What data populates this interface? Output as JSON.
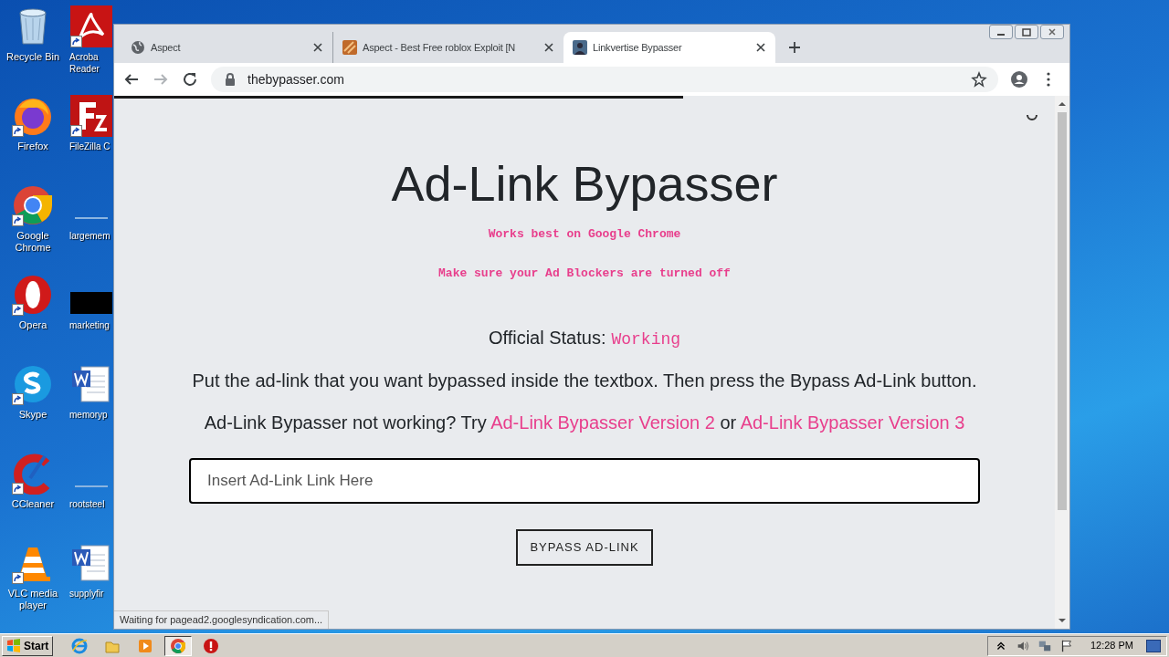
{
  "desktop_icons": [
    {
      "label": "Recycle Bin",
      "kind": "bin",
      "shortcut": false
    },
    {
      "label": "Firefox",
      "kind": "firefox",
      "shortcut": true
    },
    {
      "label": "Google Chrome",
      "kind": "chrome",
      "shortcut": true
    },
    {
      "label": "Opera",
      "kind": "opera",
      "shortcut": true
    },
    {
      "label": "Skype",
      "kind": "skype",
      "shortcut": true
    },
    {
      "label": "CCleaner",
      "kind": "ccleaner",
      "shortcut": true
    },
    {
      "label": "VLC media player",
      "kind": "vlc",
      "shortcut": true
    }
  ],
  "desktop_icons_column_2": [
    {
      "label": "Acroba Reader",
      "kind": "acrobat",
      "shortcut": true
    },
    {
      "label": "FileZilla C",
      "kind": "filezilla",
      "shortcut": true
    },
    {
      "label": "largemem",
      "kind": "blank",
      "shortcut": false
    },
    {
      "label": "marketing",
      "kind": "black",
      "shortcut": false
    },
    {
      "label": "memoryp",
      "kind": "word",
      "shortcut": false
    },
    {
      "label": "rootsteel",
      "kind": "blank",
      "shortcut": false
    },
    {
      "label": "supplyfir",
      "kind": "word",
      "shortcut": false
    }
  ],
  "browser": {
    "tabs": [
      {
        "title": "Aspect",
        "kind": "globe",
        "selected": false
      },
      {
        "title": "Aspect - Best Free roblox Exploit [N",
        "kind": "exploit",
        "selected": false
      },
      {
        "title": "Linkvertise Bypasser",
        "kind": "avatar",
        "selected": true
      }
    ],
    "address": "thebypasser.com",
    "page": {
      "title": "Ad-Link Bypasser",
      "notes": [
        "Works best on Google Chrome",
        "Make sure your Ad Blockers are turned off"
      ],
      "status_label": "Official Status:",
      "status_value": "Working",
      "instruction": "Put the ad-link that you want bypassed inside the textbox. Then press the Bypass Ad-Link button.",
      "alternative": {
        "prefix": "Ad-Link Bypasser not working? Try",
        "link_1": "Ad-Link Bypasser Version 2",
        "middle": "or",
        "link_2": "Ad-Link Bypasser Version 3"
      },
      "input": {
        "placeholder": "Insert Ad-Link Link Here"
      },
      "button": "BYPASS AD-LINK"
    },
    "status_bubble": "Waiting for pagead2.googlesyndication.com..."
  },
  "taskbar": {
    "start": "Start",
    "apps": [
      {
        "kind": "ie",
        "selected": false
      },
      {
        "kind": "explorer",
        "selected": false
      },
      {
        "kind": "media",
        "selected": false
      },
      {
        "kind": "chrome",
        "selected": true
      },
      {
        "kind": "stop",
        "selected": false
      }
    ],
    "clock": "12:28 PM"
  }
}
